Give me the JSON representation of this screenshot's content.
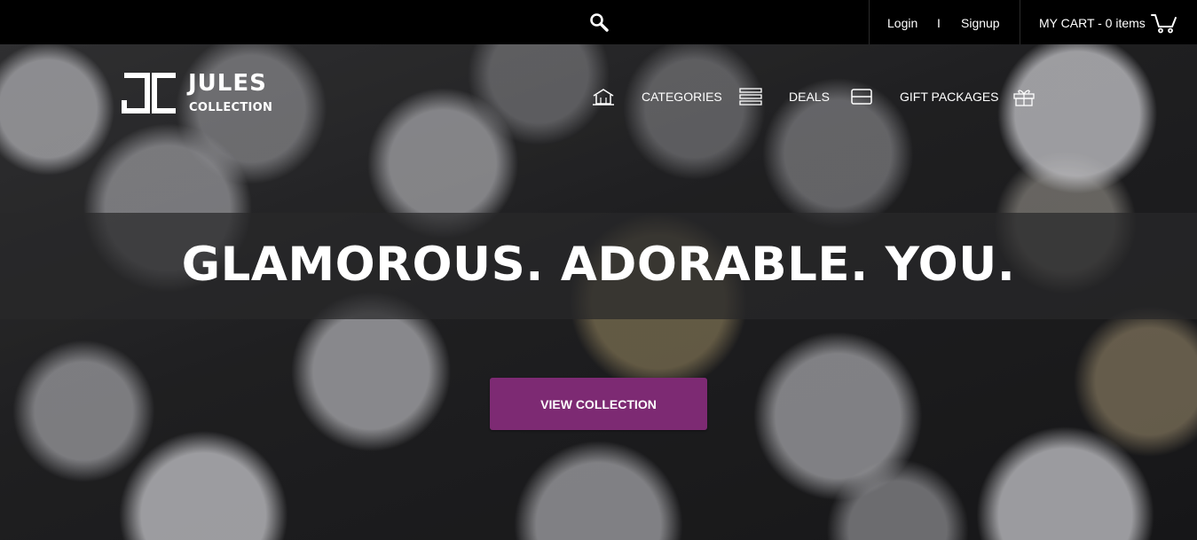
{
  "topbar": {
    "search_icon": "search-icon",
    "login_label": "Login",
    "separator": "I",
    "signup_label": "Signup",
    "cart_label": "MY CART - 0 items",
    "cart_icon": "cart-icon"
  },
  "logo": {
    "line1": "JULES",
    "line2": "COLLECTION"
  },
  "nav": {
    "items": [
      {
        "icon": "home-icon",
        "label": ""
      },
      {
        "icon": "",
        "label": "CATEGORIES"
      },
      {
        "icon": "menu-lines-icon",
        "label": ""
      },
      {
        "icon": "",
        "label": "DEALS"
      },
      {
        "icon": "tag-icon",
        "label": ""
      },
      {
        "icon": "",
        "label": "GIFT PACKAGES"
      },
      {
        "icon": "gift-icon",
        "label": ""
      }
    ]
  },
  "hero": {
    "headline": "GLAMOROUS. ADORABLE. YOU.",
    "cta_label": "VIEW COLLECTION",
    "cta_color": "#7d2a73"
  }
}
